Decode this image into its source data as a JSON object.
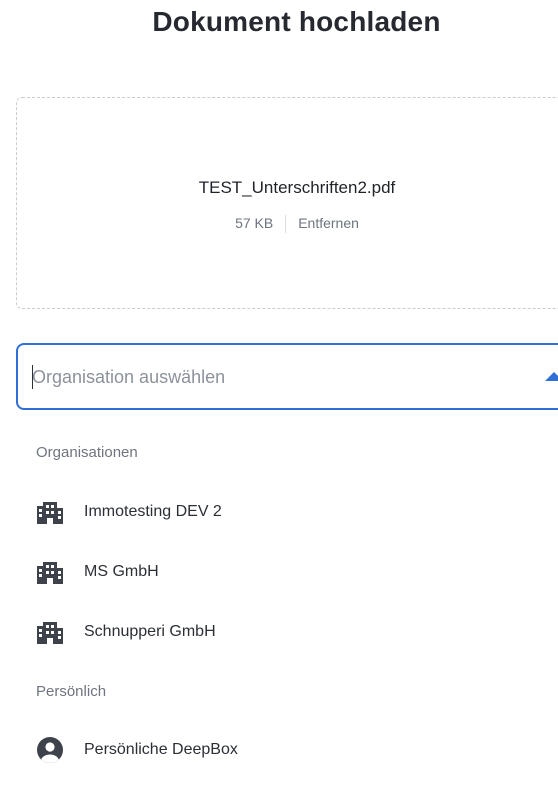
{
  "dialog": {
    "title": "Dokument hochladen"
  },
  "upload": {
    "file_name": "TEST_Unterschriften2.pdf",
    "file_size": "57 KB",
    "remove_label": "Entfernen"
  },
  "organization_select": {
    "placeholder": "Organisation auswählen",
    "value": "",
    "expanded": true
  },
  "dropdown": {
    "groups": [
      {
        "label": "Organisationen",
        "items": [
          {
            "label": "Immotesting DEV 2",
            "icon": "building-icon"
          },
          {
            "label": "MS GmbH",
            "icon": "building-icon"
          },
          {
            "label": "Schnupperi GmbH",
            "icon": "building-icon"
          }
        ]
      },
      {
        "label": "Persönlich",
        "items": [
          {
            "label": "Persönliche DeepBox",
            "icon": "user-circle-icon"
          }
        ]
      }
    ]
  },
  "colors": {
    "accent": "#2f6fd6",
    "icon": "#3d424b"
  }
}
